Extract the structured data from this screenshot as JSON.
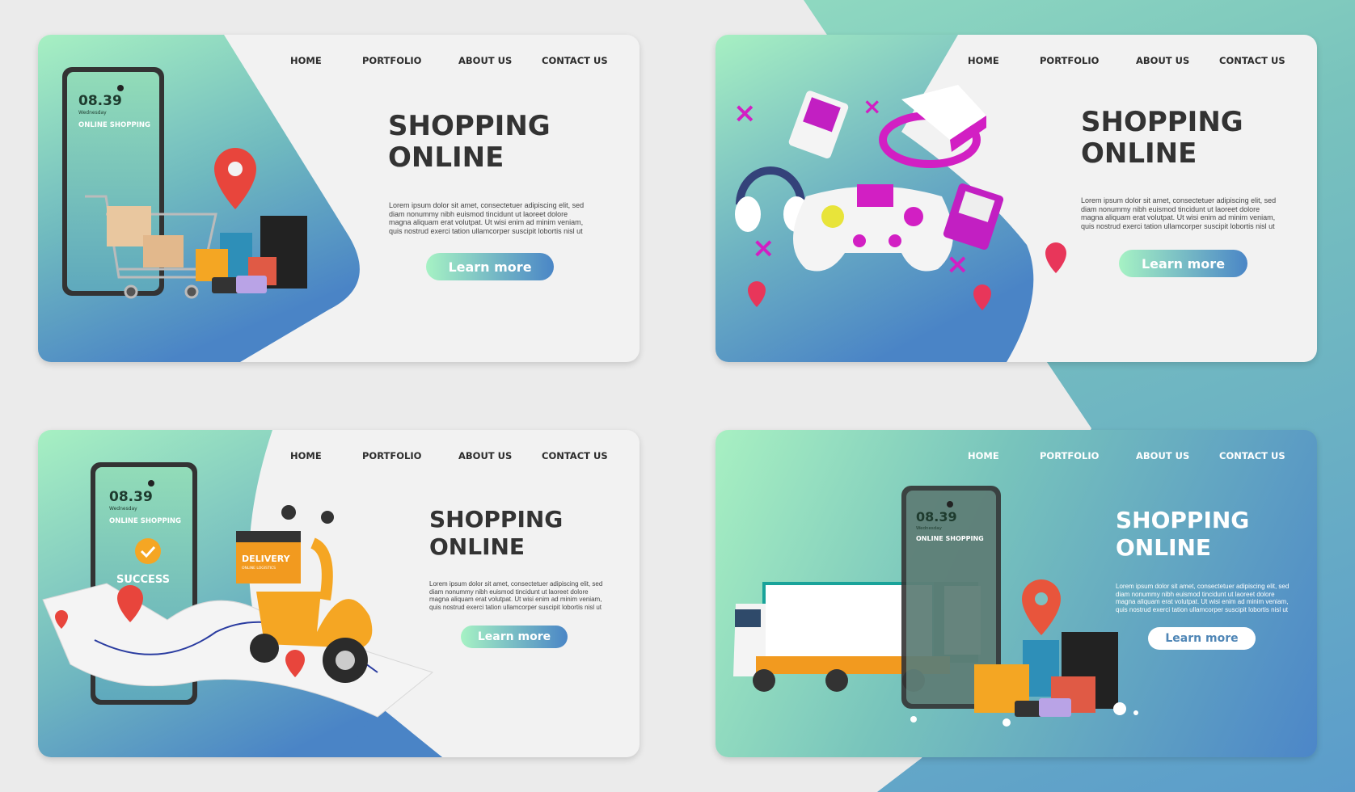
{
  "nav": [
    "HOME",
    "PORTFOLIO",
    "ABOUT US",
    "CONTACT US"
  ],
  "hero": {
    "title_line1": "SHOPPING",
    "title_line2": "ONLINE",
    "lorem": [
      "Lorem ipsum dolor sit amet, consectetuer adipiscing elit, sed",
      "diam nonummy nibh euismod tincidunt ut laoreet dolore",
      "magna aliquam erat volutpat. Ut wisi enim ad minim veniam,",
      "quis nostrud exerci tation ullamcorper suscipit lobortis nisl ut"
    ],
    "button": "Learn more"
  },
  "phone": {
    "time": "08.39",
    "day": "Wednesday",
    "label": "ONLINE SHOPPING",
    "success": "SUCCESS"
  },
  "delivery_box": {
    "title": "DELIVERY",
    "subtitle": "ONLINE LOGISTICS"
  },
  "colors": {
    "accent_start": "#a6f2c4",
    "accent_end": "#4a86c6",
    "pin": "#e8453c",
    "magenta": "#d21fc3",
    "scooter": "#f5a623"
  }
}
